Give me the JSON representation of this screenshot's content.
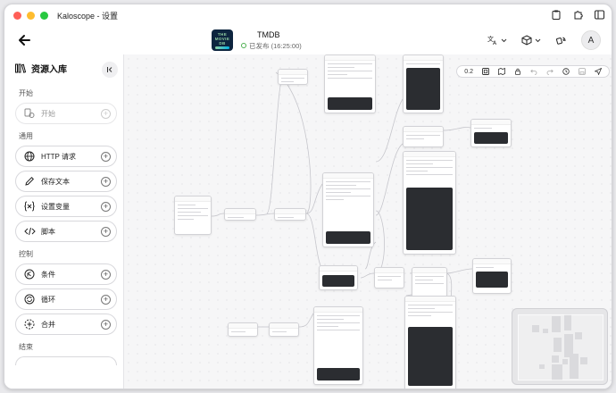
{
  "window": {
    "title": "Kaloscope - 设置"
  },
  "header": {
    "app_name": "TMDB",
    "app_status": "已发布 (16:25:00)",
    "logo_lines": [
      "THE",
      "MOVIE",
      "DB"
    ]
  },
  "sidebar": {
    "title": "资源入库",
    "sections": {
      "start": "开始",
      "common": "通用",
      "control": "控制",
      "end": "结束"
    },
    "start_item": "开始",
    "common_items": [
      "HTTP 请求",
      "保存文本",
      "设置变量",
      "脚本"
    ],
    "control_items": [
      "条件",
      "循环",
      "合并"
    ]
  },
  "toolbar": {
    "zoom": "0.2"
  },
  "avatar": {
    "initial": "A"
  },
  "colors": {
    "accent": "#0d253f",
    "tmdb_green": "#90cea1",
    "tmdb_blue": "#01b4e4",
    "status_green": "#4caf50"
  }
}
